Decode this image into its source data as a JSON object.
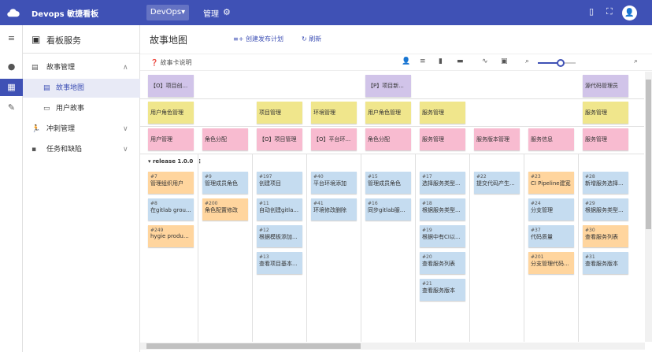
{
  "app": {
    "title": "Devops 敏捷看板",
    "project": "DevOps▾",
    "manage": "管理",
    "avatar_letter": "●"
  },
  "rail": [
    "≡",
    "●",
    "▦",
    "🔧"
  ],
  "sidebar": {
    "header": "看板服务",
    "items": [
      {
        "label": "故事管理",
        "chev": "∧"
      },
      {
        "label": "故事地图"
      },
      {
        "label": "用户故事"
      },
      {
        "label": "冲刺管理",
        "chev": "∨"
      },
      {
        "label": "任务和缺陷",
        "chev": "∨"
      }
    ]
  },
  "main": {
    "title": "故事地图",
    "create_release": "创建发布计划",
    "refresh": "刷新",
    "help": "故事卡说明",
    "zoom_level": 0.6
  },
  "board": {
    "row1": [
      {
        "col": 0,
        "text": "【O】项目创...",
        "color": "purple"
      },
      {
        "col": 4,
        "text": "【P】项目新...",
        "color": "purple"
      },
      {
        "col": 8,
        "text": "源代码管理员",
        "color": "purple"
      }
    ],
    "row2": [
      {
        "col": 0,
        "text": "用户角色管理",
        "color": "yellow"
      },
      {
        "col": 2,
        "text": "项目管理",
        "color": "yellow"
      },
      {
        "col": 3,
        "text": "环境管理",
        "color": "yellow"
      },
      {
        "col": 4,
        "text": "用户角色管理",
        "color": "yellow"
      },
      {
        "col": 5,
        "text": "服务管理",
        "color": "yellow"
      },
      {
        "col": 8,
        "text": "服务管理",
        "color": "yellow"
      }
    ],
    "row3": [
      {
        "col": 0,
        "text": "用户管理",
        "color": "pink"
      },
      {
        "col": 1,
        "text": "角色分配",
        "color": "pink"
      },
      {
        "col": 2,
        "text": "【O】项目管理",
        "color": "pink"
      },
      {
        "col": 3,
        "text": "【O】平台环...",
        "color": "pink"
      },
      {
        "col": 4,
        "text": "角色分配",
        "color": "pink"
      },
      {
        "col": 5,
        "text": "服务管理",
        "color": "pink"
      },
      {
        "col": 6,
        "text": "服务版本管理",
        "color": "pink"
      },
      {
        "col": 7,
        "text": "服务信息",
        "color": "pink"
      },
      {
        "col": 8,
        "text": "服务管理",
        "color": "pink"
      }
    ],
    "release": "release 1.0.0",
    "stories": [
      {
        "col": 0,
        "slot": 0,
        "num": "#7",
        "text": "管理组织用户",
        "color": "orange"
      },
      {
        "col": 0,
        "slot": 1,
        "num": "#8",
        "text": "在gitlab grou...",
        "color": "blue"
      },
      {
        "col": 0,
        "slot": 2,
        "num": "#249",
        "text": "hygie produc...",
        "color": "orange"
      },
      {
        "col": 1,
        "slot": 0,
        "num": "#9",
        "text": "管理成员角色",
        "color": "blue"
      },
      {
        "col": 1,
        "slot": 1,
        "num": "#200",
        "text": "角色配置修改",
        "color": "orange"
      },
      {
        "col": 2,
        "slot": 0,
        "num": "#197",
        "text": "创建项目",
        "color": "blue"
      },
      {
        "col": 2,
        "slot": 1,
        "num": "#11",
        "text": "自动创建gitla...",
        "color": "blue"
      },
      {
        "col": 2,
        "slot": 2,
        "num": "#12",
        "text": "根据模板添加...",
        "color": "blue"
      },
      {
        "col": 2,
        "slot": 3,
        "num": "#13",
        "text": "查看项目基本...",
        "color": "blue"
      },
      {
        "col": 3,
        "slot": 0,
        "num": "#40",
        "text": "平台环境添加",
        "color": "blue"
      },
      {
        "col": 3,
        "slot": 1,
        "num": "#41",
        "text": "环境修改删除",
        "color": "blue"
      },
      {
        "col": 4,
        "slot": 0,
        "num": "#15",
        "text": "管理成员角色",
        "color": "blue"
      },
      {
        "col": 4,
        "slot": 1,
        "num": "#16",
        "text": "同步gitlab服...",
        "color": "blue"
      },
      {
        "col": 5,
        "slot": 0,
        "num": "#17",
        "text": "选择服务类型...",
        "color": "blue"
      },
      {
        "col": 5,
        "slot": 1,
        "num": "#18",
        "text": "根据服务类型...",
        "color": "blue"
      },
      {
        "col": 5,
        "slot": 2,
        "num": "#19",
        "text": "根据中有CI以...",
        "color": "blue"
      },
      {
        "col": 5,
        "slot": 3,
        "num": "#20",
        "text": "查看服务列表",
        "color": "blue"
      },
      {
        "col": 5,
        "slot": 4,
        "num": "#21",
        "text": "查看服务版本",
        "color": "blue"
      },
      {
        "col": 6,
        "slot": 0,
        "num": "#22",
        "text": "提交代码产生...",
        "color": "blue"
      },
      {
        "col": 7,
        "slot": 0,
        "num": "#23",
        "text": "CI Pipeline建宽",
        "color": "orange"
      },
      {
        "col": 7,
        "slot": 1,
        "num": "#24",
        "text": "分支管理",
        "color": "blue"
      },
      {
        "col": 7,
        "slot": 2,
        "num": "#37",
        "text": "代码质量",
        "color": "blue"
      },
      {
        "col": 7,
        "slot": 3,
        "num": "#201",
        "text": "分支管理代码...",
        "color": "orange"
      },
      {
        "col": 8,
        "slot": 0,
        "num": "#28",
        "text": "新增服务选择...",
        "color": "blue"
      },
      {
        "col": 8,
        "slot": 1,
        "num": "#29",
        "text": "根据服务类型...",
        "color": "blue"
      },
      {
        "col": 8,
        "slot": 2,
        "num": "#30",
        "text": "查看服务列表",
        "color": "orange"
      },
      {
        "col": 8,
        "slot": 3,
        "num": "#31",
        "text": "查看服务版本",
        "color": "blue"
      }
    ]
  }
}
